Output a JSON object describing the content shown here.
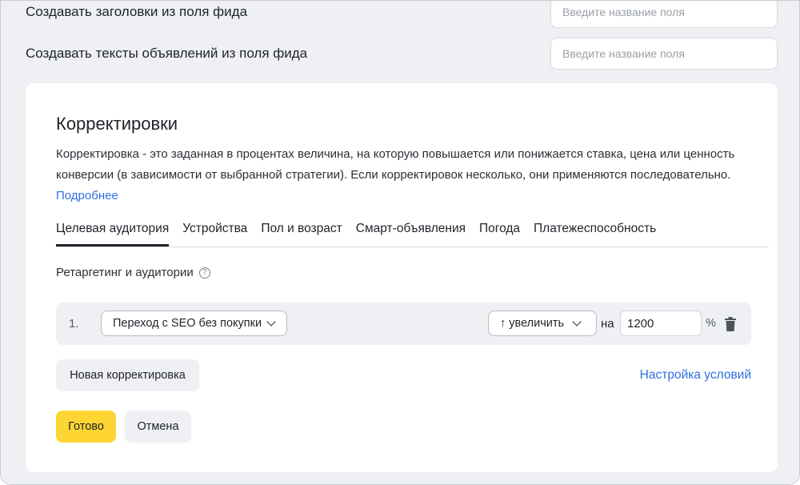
{
  "feed_settings": {
    "titles_label": "Создавать заголовки из поля фида",
    "titles_placeholder": "Введите название поля",
    "texts_label": "Создавать тексты объявлений из поля фида",
    "texts_placeholder": "Введите название поля"
  },
  "adjustments": {
    "title": "Корректировки",
    "description": "Корректировка - это заданная в процентах величина, на которую повышается или понижается ставка, цена или ценность конверсии (в зависимости от выбранной стратегии). Если корректировок несколько, они применяются последовательно. ",
    "more_link": "Подробнее",
    "tabs": [
      {
        "label": "Целевая аудитория",
        "active": true
      },
      {
        "label": "Устройства",
        "active": false
      },
      {
        "label": "Пол и возраст",
        "active": false
      },
      {
        "label": "Смарт-объявления",
        "active": false
      },
      {
        "label": "Погода",
        "active": false
      },
      {
        "label": "Платежеспособность",
        "active": false
      }
    ],
    "section_title": "Ретаргетинг и аудитории",
    "help_icon": "question-circle-icon",
    "rules": [
      {
        "index": "1.",
        "audience": "Переход с SEO без покупки",
        "modifier": "↑ увеличить",
        "on_label": "на",
        "value": "1200",
        "unit": "%",
        "delete_icon": "trash-icon"
      }
    ],
    "new_adjustment_button": "Новая корректировка",
    "conditions_link": "Настройка условий",
    "done_button": "Готово",
    "cancel_button": "Отмена"
  },
  "colors": {
    "primary_button": "#fdd633",
    "link": "#2f6fde",
    "background": "#eef0f3"
  }
}
